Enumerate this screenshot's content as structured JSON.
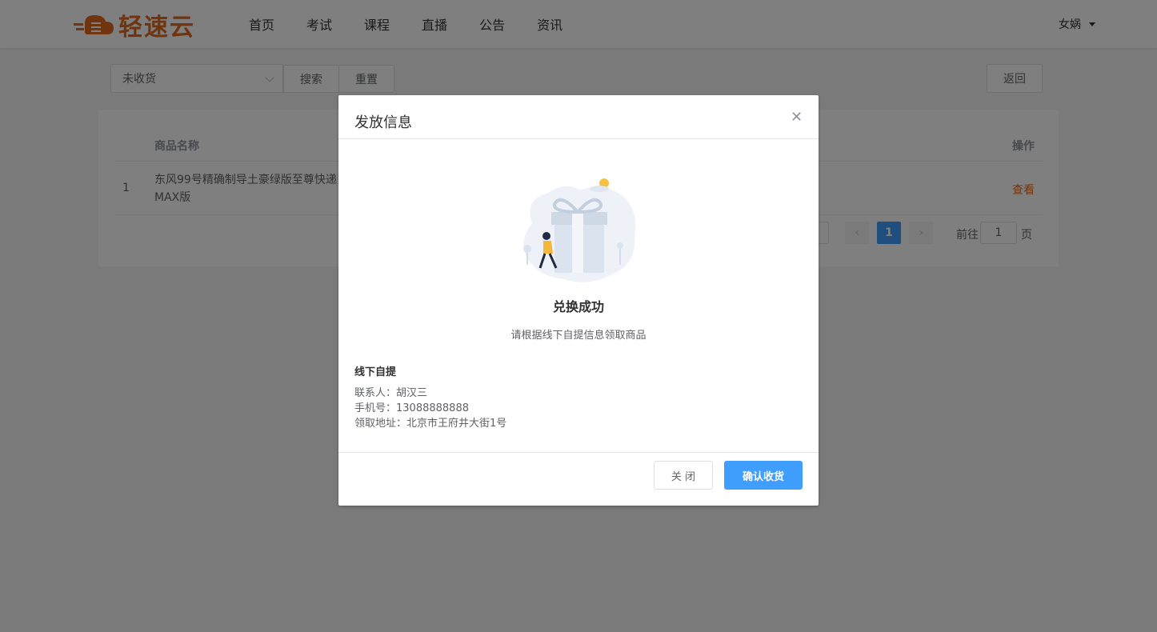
{
  "header": {
    "brand": "轻速云",
    "nav": [
      "首页",
      "考试",
      "课程",
      "直播",
      "公告",
      "资讯"
    ],
    "user": "女娲"
  },
  "toolbar": {
    "status_select": "未收货",
    "search_label": "搜索",
    "reset_label": "重置",
    "back_label": "返回"
  },
  "table": {
    "columns": {
      "name": "商品名称",
      "action": "操作"
    },
    "rows": [
      {
        "index": "1",
        "name": "东风99号精确制导土豪绿版至尊快递 MAX版",
        "action": "查看"
      }
    ]
  },
  "pagination": {
    "current_page": "1",
    "goto_label": "前往",
    "goto_value": "1",
    "page_unit": "页",
    "prev_icon": "chevron-left-icon",
    "next_icon": "chevron-right-icon"
  },
  "dialog": {
    "title": "发放信息",
    "close_icon": "close-icon",
    "success_title": "兑换成功",
    "hint": "请根据线下自提信息领取商品",
    "section_title": "线下自提",
    "contact": "联系人：胡汉三",
    "phone": "手机号：13088888888",
    "address": "领取地址：北京市王府井大街1号",
    "close_button": "关 闭",
    "confirm_button": "确认收货"
  },
  "colors": {
    "brand": "#e06a1f",
    "primary": "#409eff",
    "overlay": "rgba(0,0,0,0.5)"
  }
}
